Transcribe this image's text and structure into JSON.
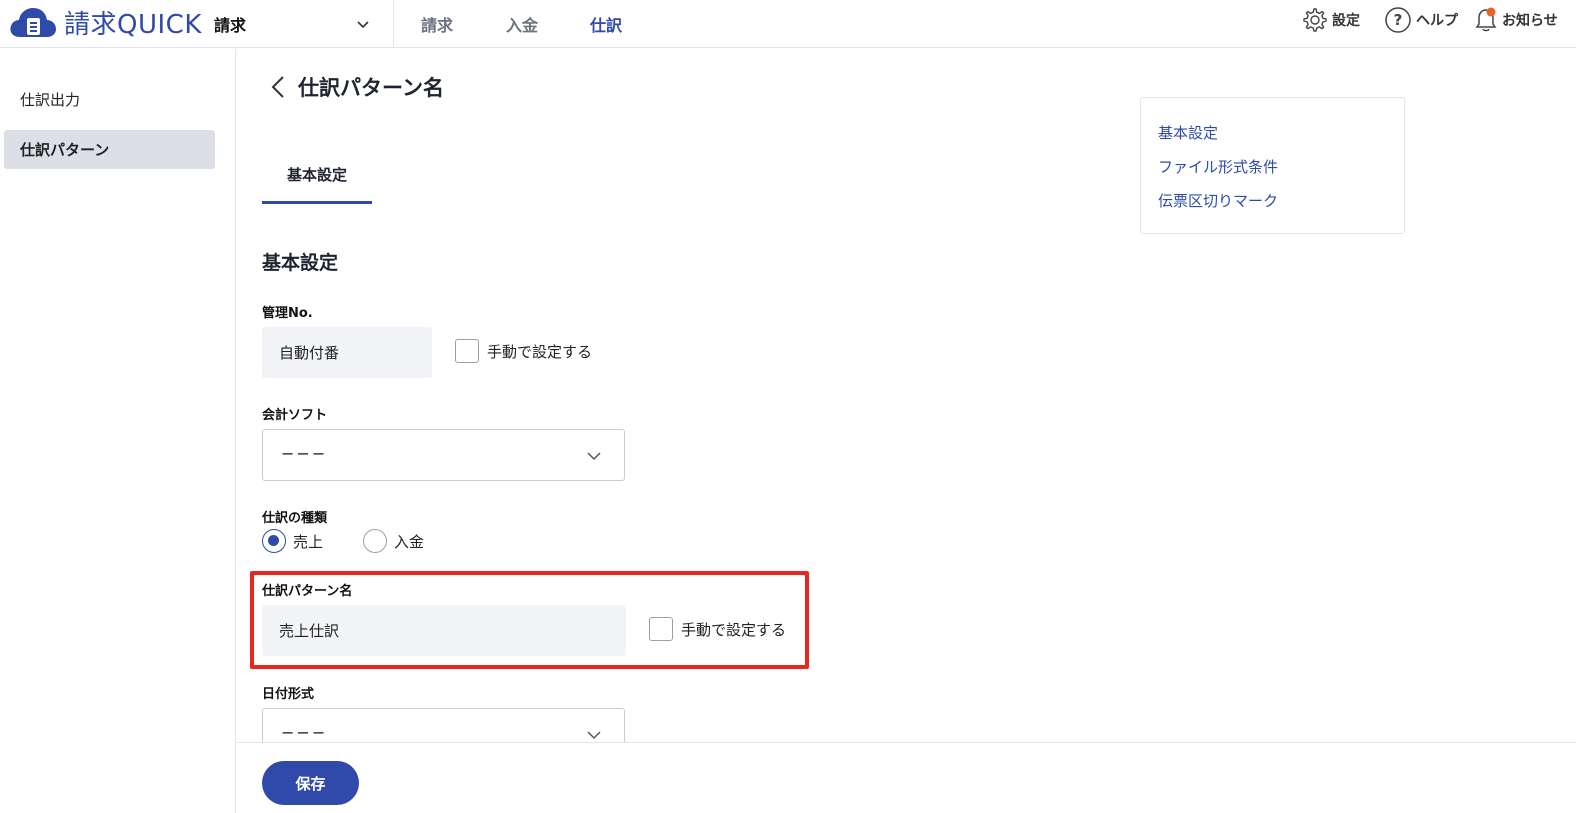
{
  "header": {
    "logo_text": "請求QUICK",
    "service_select": "請求",
    "nav_tabs": [
      "請求",
      "入金",
      "仕訳"
    ],
    "active_tab": "仕訳",
    "settings_label": "設定",
    "help_label": "ヘルプ",
    "notice_label": "お知らせ",
    "brand_color": "#2f4aa8",
    "notice_badge_color": "#e8632a"
  },
  "sidebar": {
    "items": [
      {
        "label": "仕訳出力"
      },
      {
        "label": "仕訳パターン"
      }
    ]
  },
  "main": {
    "page_title": "仕訳パターン名",
    "tab_label": "基本設定",
    "section_title": "基本設定",
    "fields": {
      "management_no": {
        "label": "管理No.",
        "value": "自動付番",
        "checkbox_label": "手動で設定する"
      },
      "accounting_software": {
        "label": "会計ソフト",
        "value": "−−−"
      },
      "journal_type": {
        "label": "仕訳の種類",
        "options": [
          "売上",
          "入金"
        ],
        "selected": "売上"
      },
      "pattern_name": {
        "label": "仕訳パターン名",
        "value": "売上仕訳",
        "checkbox_label": "手動で設定する"
      },
      "date_format": {
        "label": "日付形式",
        "value": "−−−"
      }
    }
  },
  "toc": {
    "links": [
      "基本設定",
      "ファイル形式条件",
      "伝票区切りマーク"
    ]
  },
  "footer": {
    "save_label": "保存"
  },
  "annotation": {
    "highlight_color": "#e8281f"
  }
}
